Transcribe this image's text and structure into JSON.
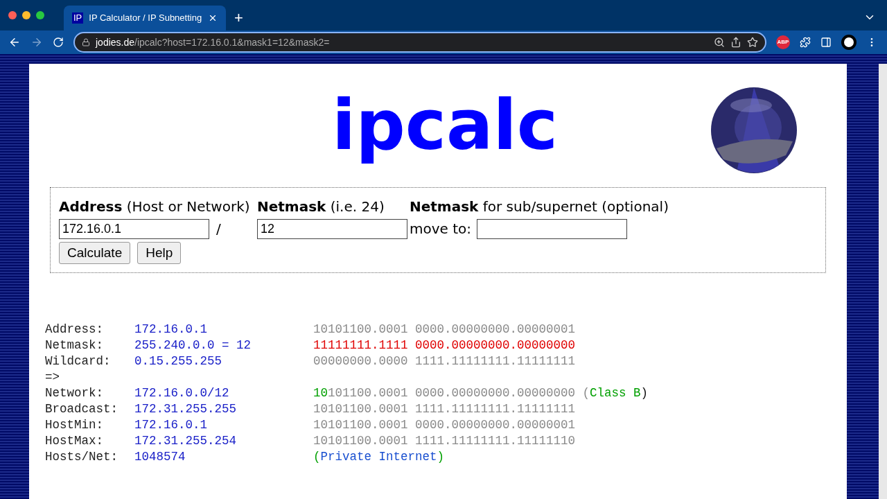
{
  "browser": {
    "tab": {
      "favicon": "IP",
      "title": "IP Calculator / IP Subnetting"
    },
    "new_tab": "+",
    "address": {
      "host": "jodies.de",
      "path": "/ipcalc?host=172.16.0.1&mask1=12&mask2="
    },
    "extension_badge": "ABP"
  },
  "page": {
    "heading": "ipcalc",
    "form": {
      "address_label": {
        "bold": "Address",
        "rest": " (Host or Network)"
      },
      "address_value": "172.16.0.1",
      "slash": "/",
      "netmask_label": {
        "bold": "Netmask",
        "rest": " (i.e. 24)"
      },
      "netmask_value": "12",
      "netmask2_label": {
        "bold": "Netmask",
        "rest": " for sub/supernet (optional)"
      },
      "move_to": "move to:",
      "buttons": [
        "Calculate",
        "Help"
      ]
    },
    "results": [
      {
        "label": "Address:",
        "value": "172.16.0.1",
        "binary": [
          {
            "text": "10101100.0001 0000.00000000.00000001",
            "kind": "gray"
          }
        ]
      },
      {
        "label": "Netmask:",
        "value": "255.240.0.0 = 12",
        "binary": [
          {
            "text": "11111111.1111 0000.00000000.00000000",
            "kind": "red"
          }
        ]
      },
      {
        "label": "Wildcard:",
        "value": "0.15.255.255",
        "binary": [
          {
            "text": "00000000.0000 1111.11111111.11111111",
            "kind": "gray"
          }
        ]
      },
      {
        "label": "=>"
      },
      {
        "label": "Network:",
        "value": "172.16.0.0/12",
        "binary": [
          {
            "text": "10",
            "kind": "green"
          },
          {
            "text": "101100.0001 0000.00000000.00000000 (",
            "kind": "gray"
          },
          {
            "text": "Class B",
            "kind": "green"
          },
          {
            "text": ")",
            "kind": "black"
          }
        ]
      },
      {
        "label": "Broadcast:",
        "value": "172.31.255.255",
        "binary": [
          {
            "text": "10101100.0001 1111.11111111.11111111",
            "kind": "gray"
          }
        ]
      },
      {
        "label": "HostMin:",
        "value": "172.16.0.1",
        "binary": [
          {
            "text": "10101100.0001 0000.00000000.00000001",
            "kind": "gray"
          }
        ]
      },
      {
        "label": "HostMax:",
        "value": "172.31.255.254",
        "binary": [
          {
            "text": "10101100.0001 1111.11111111.11111110",
            "kind": "gray"
          }
        ]
      },
      {
        "label": "Hosts/Net:",
        "value": "1048574",
        "binary": [
          {
            "text": "(",
            "kind": "green"
          },
          {
            "text": "Private Internet",
            "kind": "blue"
          },
          {
            "text": ")",
            "kind": "green"
          }
        ]
      }
    ]
  }
}
